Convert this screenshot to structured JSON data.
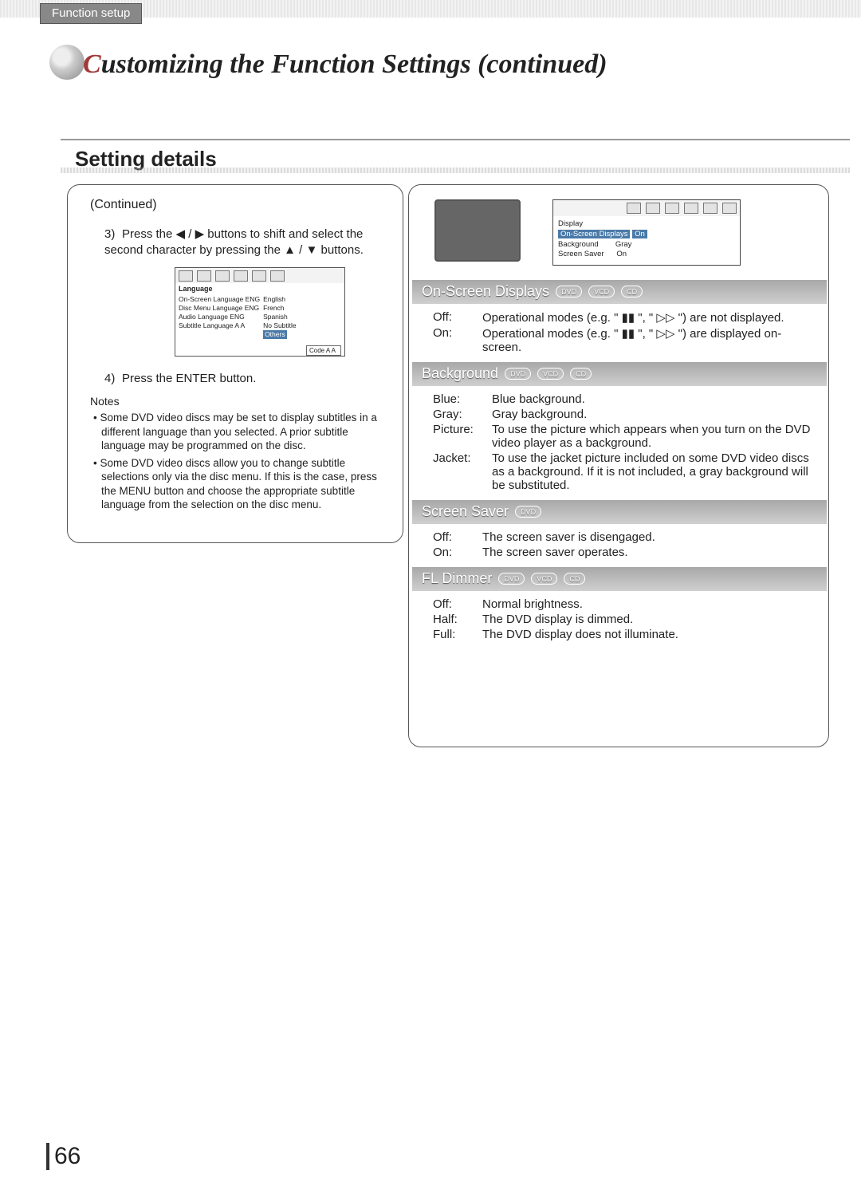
{
  "header": {
    "tab": "Function setup",
    "title_red_letter": "C",
    "title_rest": "ustomizing the Function Settings (continued)"
  },
  "section_title": "Setting details",
  "left": {
    "continued": "(Continued)",
    "step3_num": "3)",
    "step3": "Press the ◀ / ▶ buttons to shift and select the second character by pressing the ▲ / ▼ buttons.",
    "step4_num": "4)",
    "step4": "Press the ENTER button.",
    "notes_hd": "Notes",
    "notes": [
      "Some DVD video discs may be set to display subtitles in a different language than you selected. A prior subtitle language may be programmed on the disc.",
      "Some DVD video discs allow you to change subtitle selections only via the disc menu. If this is the case, press the MENU button and choose the appropriate subtitle language from the selection on the disc menu."
    ],
    "langbox": {
      "title": "Language",
      "rows": [
        "On-Screen Language  ENG",
        "Disc Menu Language  ENG",
        "Audio Language      ENG",
        "Subtitle Language   A  A"
      ],
      "opts": [
        "English",
        "French",
        "Spanish",
        "No Subtitle"
      ],
      "other": "Others",
      "code": "Code  A A"
    }
  },
  "right": {
    "osd_box": {
      "title": "Display",
      "rows": [
        [
          "On-Screen Displays",
          "On"
        ],
        [
          "Background",
          "Gray"
        ],
        [
          "Screen Saver",
          "On"
        ]
      ]
    },
    "sec_osd": {
      "title": "On-Screen Displays",
      "badges": [
        "DVD",
        "VCD",
        "CD"
      ],
      "off_k": "Off:",
      "off_v": "Operational modes (e.g. \" ▮▮ \", \" ▷▷ \") are not displayed.",
      "on_k": "On:",
      "on_v": "Operational modes (e.g. \" ▮▮ \", \" ▷▷ \") are displayed on-screen."
    },
    "sec_bg": {
      "title": "Background",
      "badges": [
        "DVD",
        "VCD",
        "CD"
      ],
      "rows": [
        [
          "Blue:",
          "Blue background."
        ],
        [
          "Gray:",
          "Gray background."
        ],
        [
          "Picture:",
          "To use the picture which appears when you turn on the DVD video player as a background."
        ],
        [
          "Jacket:",
          "To use the jacket picture included on some DVD video discs as a background. If it is not included, a gray background will be substituted."
        ]
      ]
    },
    "sec_ss": {
      "title": "Screen Saver",
      "badges": [
        "DVD"
      ],
      "off_k": "Off:",
      "off_v": "The screen saver is disengaged.",
      "on_k": "On:",
      "on_v": "The screen saver operates."
    },
    "sec_fl": {
      "title": "FL Dimmer",
      "badges": [
        "DVD",
        "VCD",
        "CD"
      ],
      "rows": [
        [
          "Off:",
          "Normal brightness."
        ],
        [
          "Half:",
          "The DVD display is dimmed."
        ],
        [
          "Full:",
          "The DVD display does not illuminate."
        ]
      ]
    }
  },
  "page_number": "66"
}
